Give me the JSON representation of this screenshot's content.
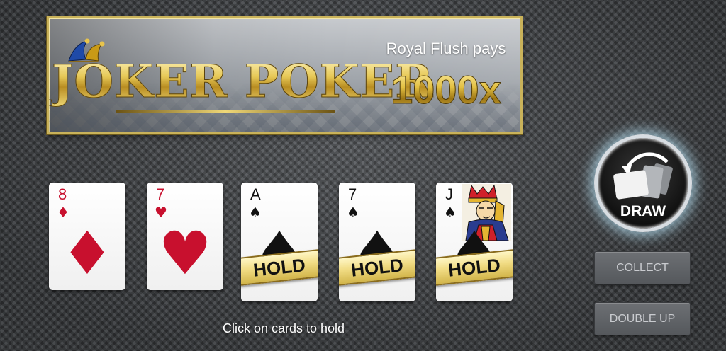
{
  "banner": {
    "logo_text": "JOKER POKER",
    "promo_label": "Royal Flush pays",
    "promo_value": "1000x"
  },
  "cards": [
    {
      "rank": "8",
      "suit": "diamond",
      "suit_glyph": "♦",
      "color": "#c8102e",
      "held": false
    },
    {
      "rank": "7",
      "suit": "heart",
      "suit_glyph": "♥",
      "color": "#c8102e",
      "held": false
    },
    {
      "rank": "A",
      "suit": "spade",
      "suit_glyph": "♠",
      "color": "#111111",
      "held": true
    },
    {
      "rank": "7",
      "suit": "spade",
      "suit_glyph": "♠",
      "color": "#111111",
      "held": true
    },
    {
      "rank": "J",
      "suit": "spade",
      "suit_glyph": "♠",
      "color": "#111111",
      "held": true
    }
  ],
  "hold_label": "HOLD",
  "hint": "Click on cards to hold",
  "buttons": {
    "draw": "DRAW",
    "collect": "COLLECT",
    "double_up": "DOUBLE UP"
  },
  "icons": {
    "logo_hat": "jester-hat-icon",
    "draw": "draw-cards-icon",
    "jack_face": "jack-face-icon"
  }
}
